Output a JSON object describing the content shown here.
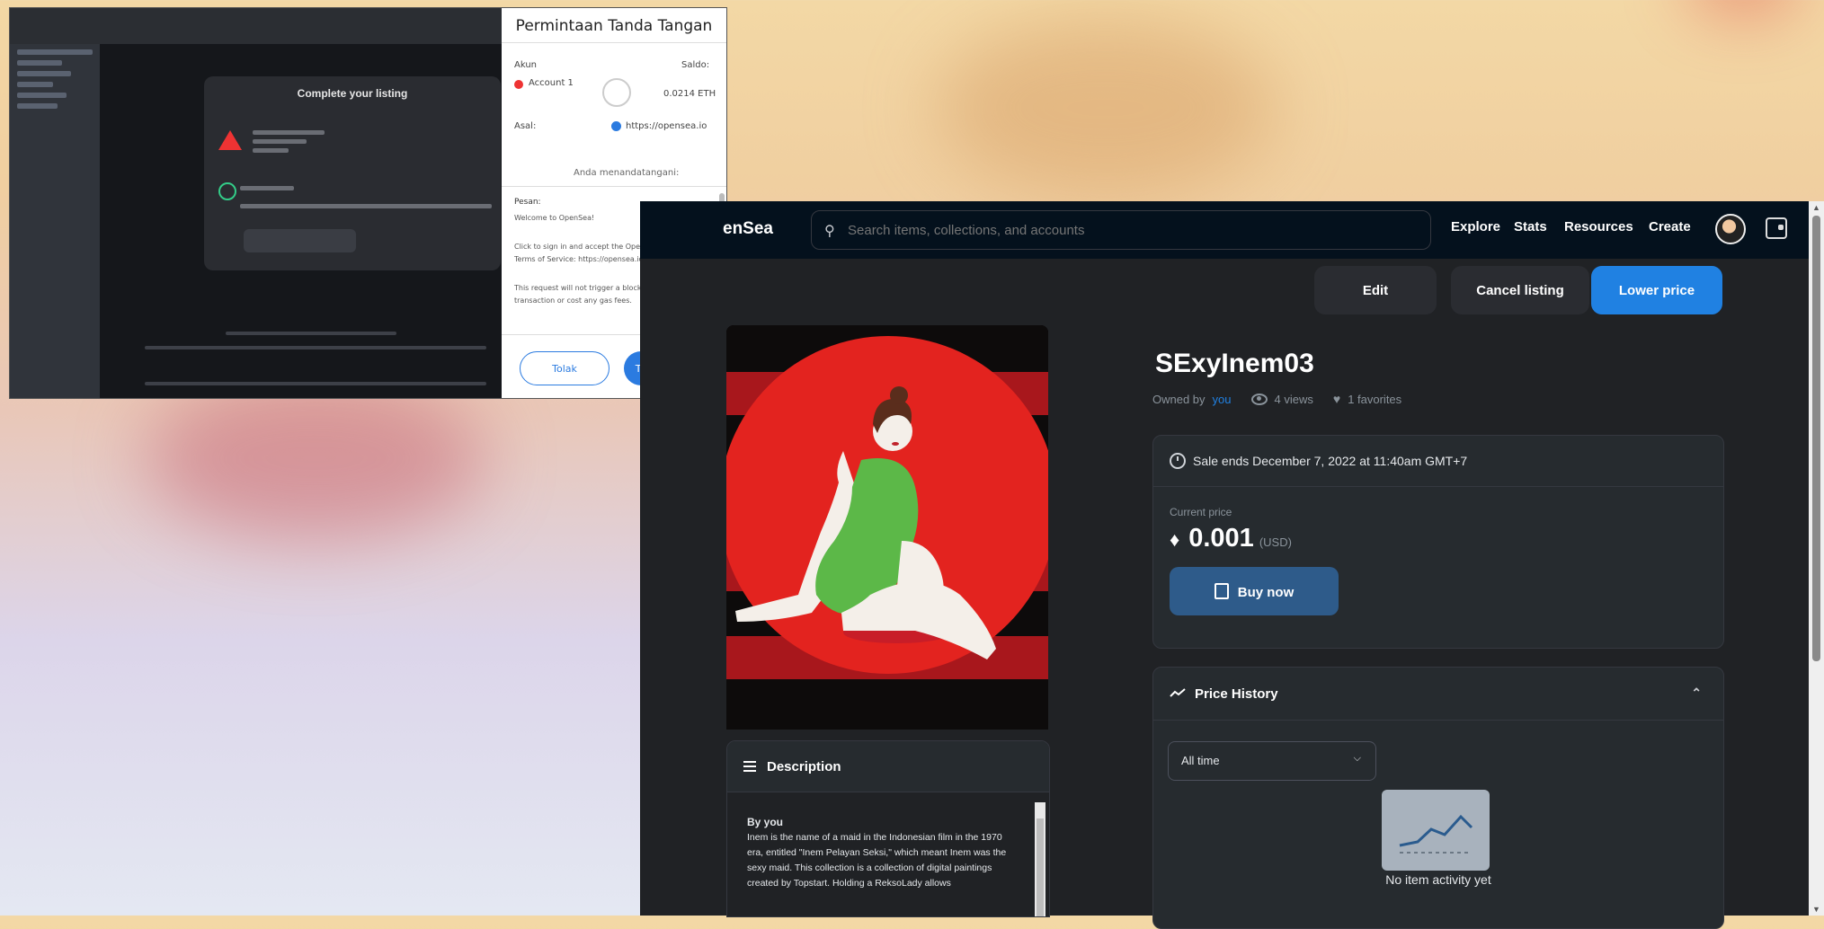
{
  "capture": {
    "modal_title": "Complete your listing",
    "wallet": {
      "title": "Permintaan Tanda Tangan",
      "account_label": "Akun",
      "balance_label": "Saldo:",
      "account_name": "Account 1",
      "balance_value": "0.0214 ETH",
      "origin_label": "Asal:",
      "origin_value": "https://opensea.io",
      "message_header": "Anda menandatangani:",
      "message_label": "Pesan:",
      "message_lines": [
        "Welcome to OpenSea!",
        "Click to sign in and accept the OpenSea",
        "Terms of Service: https://opensea.io/tos",
        "This request will not trigger a blockchain",
        "transaction or cost any gas fees."
      ],
      "cancel_label": "Tolak",
      "sign_label": "Tanda tangan"
    }
  },
  "opensea": {
    "brand": "enSea",
    "search_placeholder": "Search items, collections, and accounts",
    "nav": [
      "Explore",
      "Stats",
      "Resources",
      "Create"
    ],
    "actions": {
      "edit": "Edit",
      "cancel": "Cancel listing",
      "lower": "Lower price"
    },
    "item": {
      "title": "SExyInem03",
      "owned_by_label": "Owned by",
      "owner": "you",
      "views": "4 views",
      "favorites": "1 favorites"
    },
    "sale": {
      "ends_text": "Sale ends December 7, 2022 at 11:40am GMT+7",
      "current_price_label": "Current price",
      "price": "0.001",
      "usd": "(USD)",
      "buy_label": "Buy now"
    },
    "price_history": {
      "title": "Price History",
      "filter": "All time",
      "empty_text": "No item activity yet"
    },
    "description": {
      "title": "Description",
      "by": "By you",
      "text": "Inem is the name of a maid in the Indonesian film in the 1970 era, entitled \"Inem Pelayan Seksi,\" which meant Inem was the sexy maid. This collection is a collection of digital paintings created by Topstart. Holding a ReksoLady allows"
    }
  },
  "colors": {
    "accent": "#2081e2",
    "background": "#202225",
    "art_red": "#e3231f",
    "dress_green": "#5cb848"
  }
}
